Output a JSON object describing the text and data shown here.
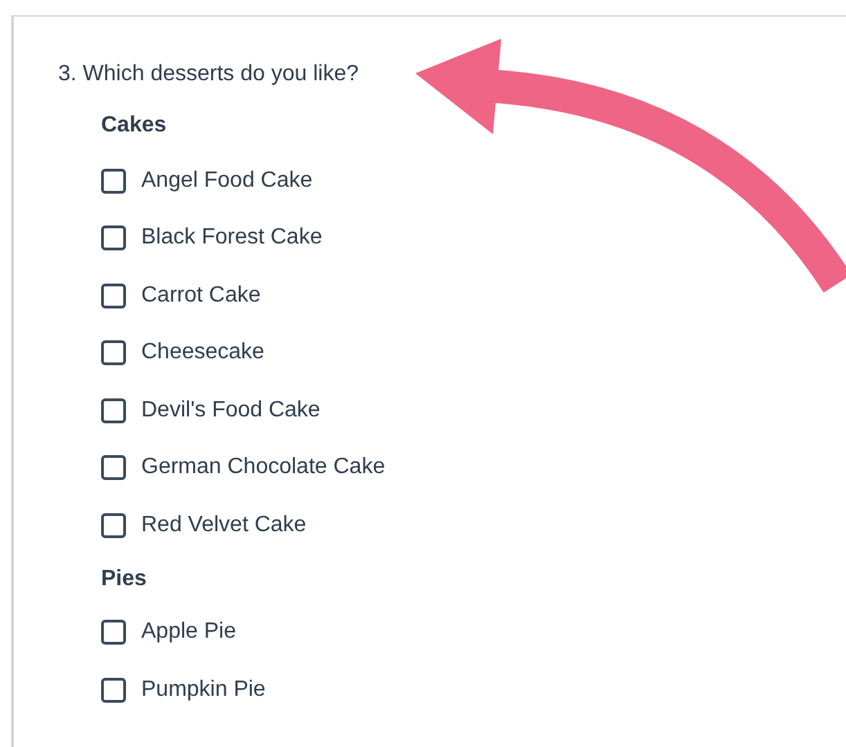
{
  "question": {
    "title": "3. Which desserts do you like?"
  },
  "groups": [
    {
      "title": "Cakes",
      "options": [
        {
          "label": "Angel Food Cake",
          "checked": false
        },
        {
          "label": "Black Forest Cake",
          "checked": false
        },
        {
          "label": "Carrot Cake",
          "checked": false
        },
        {
          "label": "Cheesecake",
          "checked": false
        },
        {
          "label": "Devil's Food Cake",
          "checked": false
        },
        {
          "label": "German Chocolate Cake",
          "checked": false
        },
        {
          "label": "Red Velvet Cake",
          "checked": false
        }
      ]
    },
    {
      "title": "Pies",
      "options": [
        {
          "label": "Apple Pie",
          "checked": false
        },
        {
          "label": "Pumpkin Pie",
          "checked": false
        }
      ]
    }
  ]
}
